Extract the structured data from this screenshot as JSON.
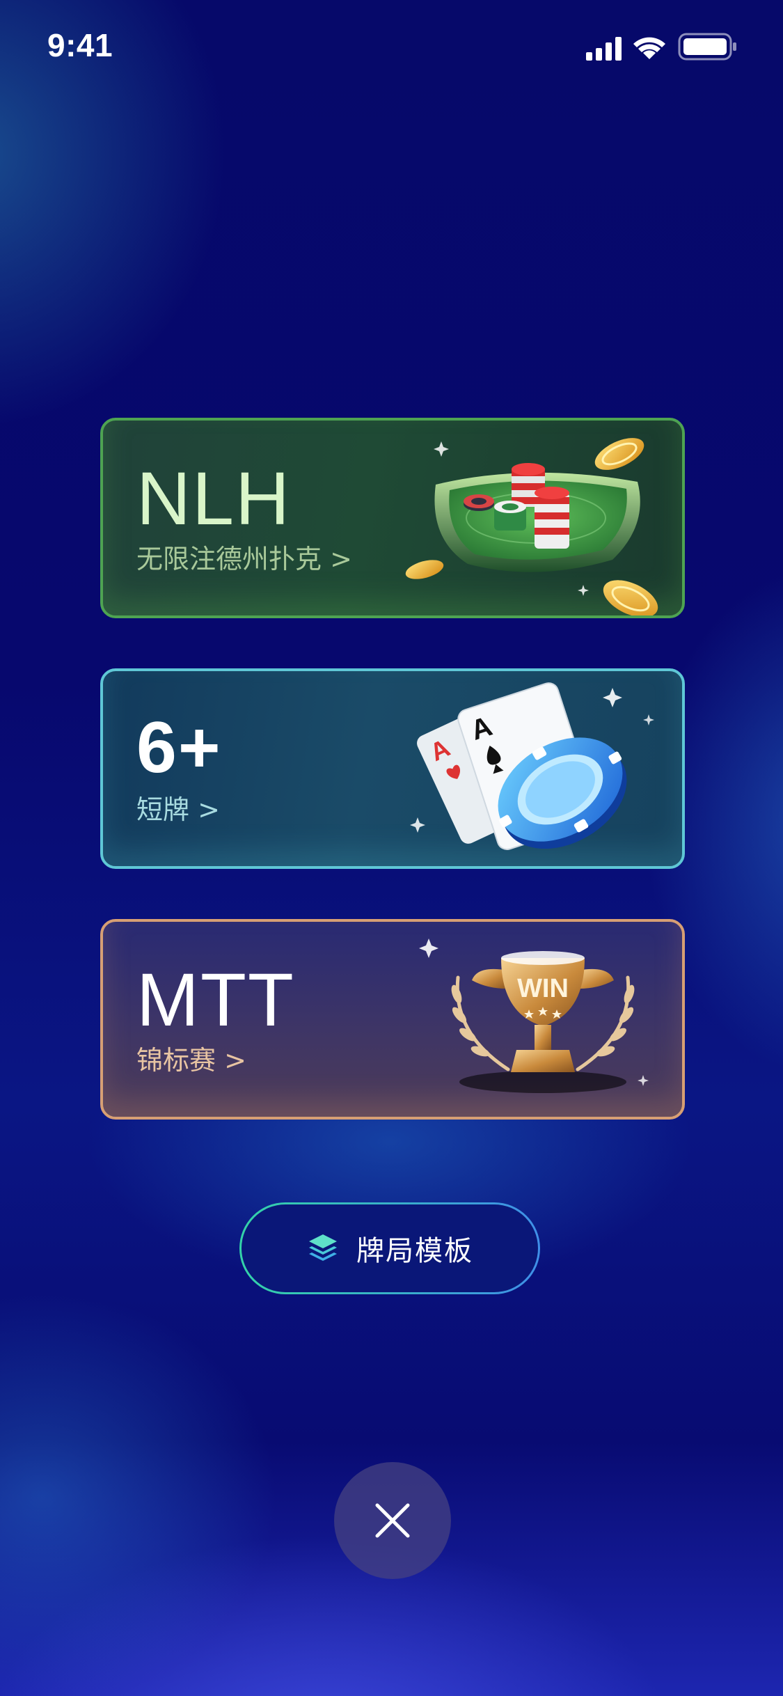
{
  "status_bar": {
    "time": "9:41",
    "icons": [
      "signal-icon",
      "wifi-icon",
      "battery-icon"
    ]
  },
  "cards": [
    {
      "id": "nlh",
      "title": "NLH",
      "subtitle": "无限注德州扑克 >",
      "accent": "#4ea352",
      "illustration": "poker-table-chips"
    },
    {
      "id": "6plus",
      "title": "6+",
      "subtitle": "短牌 >",
      "accent": "#5fc7d6",
      "illustration": "ace-cards-chip"
    },
    {
      "id": "mtt",
      "title": "MTT",
      "subtitle": "锦标赛 >",
      "accent": "#d79f74",
      "illustration": "win-trophy",
      "illustration_text": "WIN"
    }
  ],
  "template_button": {
    "label": "牌局模板",
    "icon": "layers-icon"
  },
  "close_button": {
    "icon": "close-icon"
  },
  "colors": {
    "background": "#070a6a",
    "button_border_start": "#34d3a8",
    "button_border_end": "#3f8fe8"
  }
}
